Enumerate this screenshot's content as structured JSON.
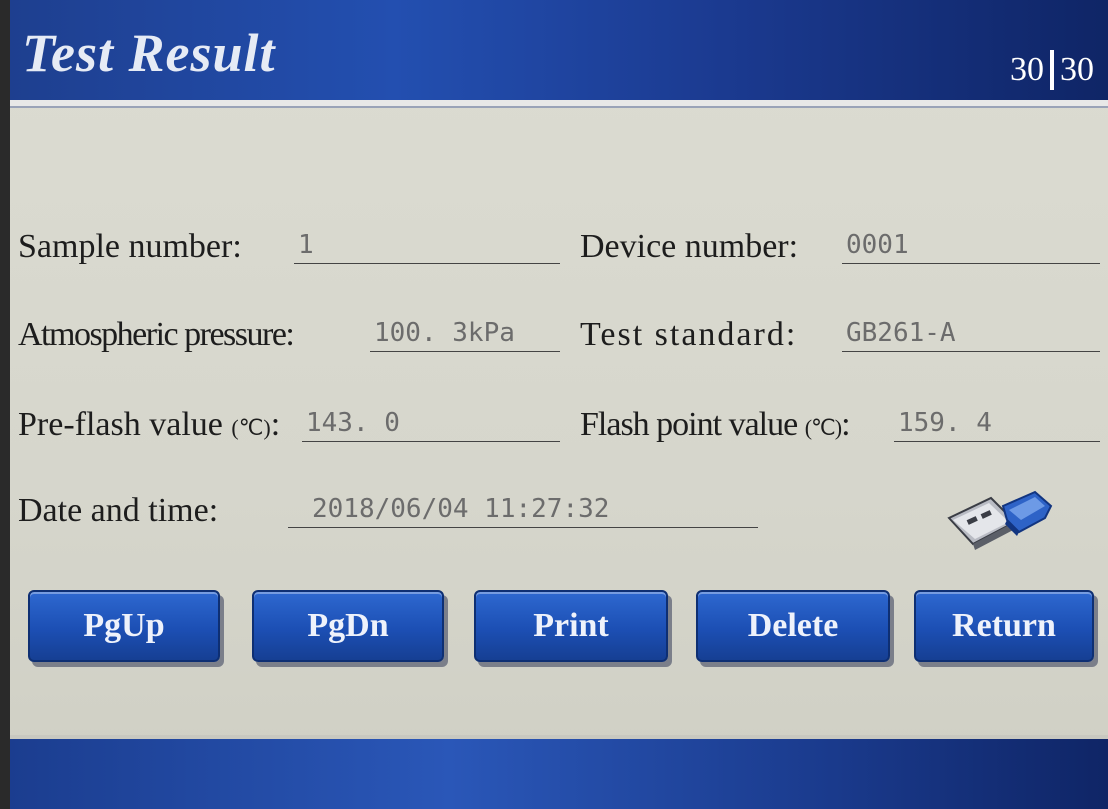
{
  "header": {
    "title": "Test Result",
    "current_page": "30",
    "total_pages": "30"
  },
  "fields": {
    "sample_number": {
      "label": "Sample number:",
      "value": "1"
    },
    "device_number": {
      "label": "Device number:",
      "value": "0001"
    },
    "atmospheric_pressure": {
      "label": "Atmospheric pressure:",
      "value": "100. 3kPa"
    },
    "test_standard": {
      "label": "Test standard:",
      "value": "GB261-A"
    },
    "pre_flash": {
      "label": "Pre-flash value ",
      "unit": "(℃)",
      "colon": ":",
      "value": "143. 0"
    },
    "flash_point": {
      "label": "Flash point value ",
      "unit": "(℃)",
      "colon": ":",
      "value": "159. 4"
    },
    "date_time": {
      "label": "Date and time:",
      "value": "2018/06/04 11:27:32"
    }
  },
  "icons": {
    "usb": "usb-drive-icon"
  },
  "buttons": {
    "pgup": "PgUp",
    "pgdn": "PgDn",
    "print": "Print",
    "delete": "Delete",
    "return": "Return"
  },
  "colors": {
    "header_blue": "#234fb0",
    "button_blue": "#1c4fb4",
    "screen_bg": "#d6d6cc"
  }
}
